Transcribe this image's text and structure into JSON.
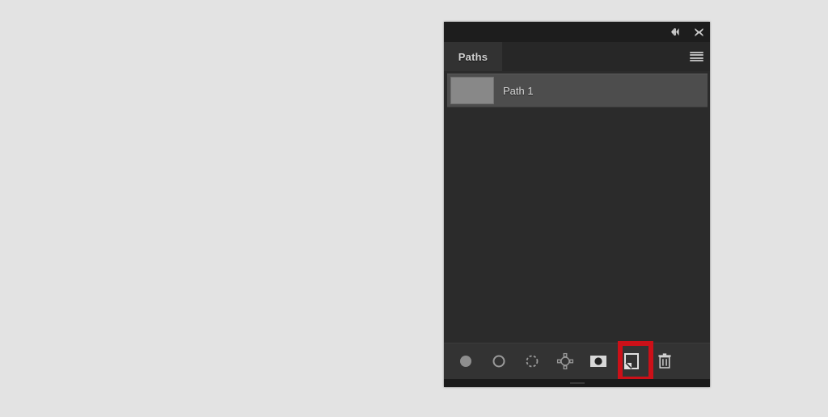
{
  "app": {
    "panel_title": "Paths",
    "background_color": "#e3e3e3",
    "panel_background": "#2b2b2b",
    "highlight_color": "#cc1018"
  },
  "titlebar": {
    "collapse_icon": "collapse-to-icons-icon",
    "collapse_label": "Collapse to Icons",
    "close_icon": "close-icon",
    "close_label": "Close"
  },
  "tabs": [
    {
      "label": "Paths",
      "active": true
    }
  ],
  "panel_menu": {
    "icon": "hamburger-menu-icon",
    "label": "Panel Menu"
  },
  "paths": [
    {
      "name": "Path 1",
      "selected": true,
      "thumbnail_color": "#888888"
    }
  ],
  "toolbar": {
    "buttons": [
      {
        "id": "fill-path",
        "icon": "filled-circle-icon",
        "label": "Fill path with foreground color",
        "highlighted": false
      },
      {
        "id": "stroke-path",
        "icon": "circle-outline-icon",
        "label": "Stroke path with brush",
        "highlighted": false
      },
      {
        "id": "load-selection",
        "icon": "dashed-circle-icon",
        "label": "Load path as a selection",
        "highlighted": false
      },
      {
        "id": "make-work-path",
        "icon": "anchor-points-circle-icon",
        "label": "Make work path from selection",
        "highlighted": false
      },
      {
        "id": "add-mask",
        "icon": "layer-mask-icon",
        "label": "Add layer mask",
        "highlighted": false
      },
      {
        "id": "create-new-path",
        "icon": "new-page-icon",
        "label": "Create new path",
        "highlighted": true
      },
      {
        "id": "delete-path",
        "icon": "trash-icon",
        "label": "Delete current path",
        "highlighted": false
      }
    ]
  }
}
